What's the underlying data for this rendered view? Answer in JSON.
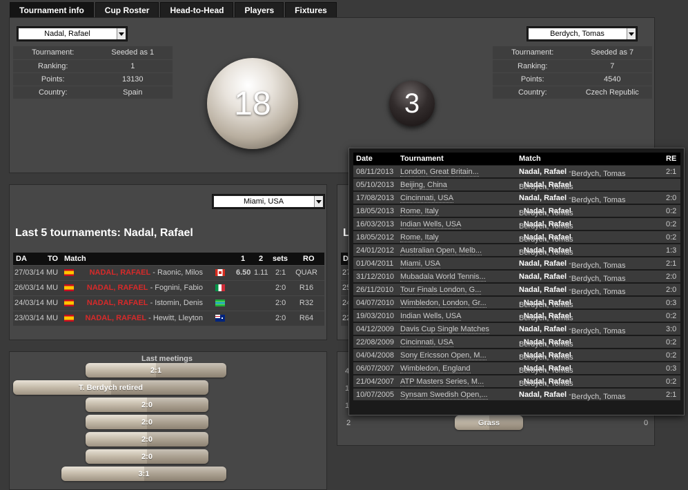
{
  "tabs": [
    "Tournament info",
    "Cup Roster",
    "Head-to-Head",
    "Players",
    "Fixtures"
  ],
  "player1": {
    "name": "Nadal, Rafael",
    "info": [
      [
        "Tournament:",
        "Seeded as 1"
      ],
      [
        "Ranking:",
        "1"
      ],
      [
        "Points:",
        "13130"
      ],
      [
        "Country:",
        "Spain"
      ]
    ],
    "wins": "18"
  },
  "player2": {
    "name": "Berdych, Tomas",
    "info": [
      [
        "Tournament:",
        "Seeded as 7"
      ],
      [
        "Ranking:",
        "7"
      ],
      [
        "Points:",
        "4540"
      ],
      [
        "Country:",
        "Czech Republic"
      ]
    ],
    "wins": "3"
  },
  "last5": {
    "filter": "Miami, USA",
    "title": "Last 5 tournaments: Nadal, Rafael",
    "headers": [
      "DA",
      "TO",
      "Match",
      "1",
      "2",
      "sets",
      "RO"
    ],
    "rows": [
      {
        "date": "27/03/14",
        "to": "MU",
        "player": "NADAL, RAFAEL",
        "opp": " - Raonic, Milos",
        "flag": "ca",
        "s1": "6.50",
        "s2": "1.11",
        "sets": "2:1",
        "ro": "QUAR"
      },
      {
        "date": "26/03/14",
        "to": "MU",
        "player": "NADAL, RAFAEL",
        "opp": " - Fognini, Fabio",
        "flag": "it",
        "s1": "",
        "s2": "",
        "sets": "2:0",
        "ro": "R16"
      },
      {
        "date": "24/03/14",
        "to": "MU",
        "player": "NADAL, RAFAEL",
        "opp": " - Istomin, Denis",
        "flag": "kz",
        "s1": "",
        "s2": "",
        "sets": "2:0",
        "ro": "R32"
      },
      {
        "date": "23/03/14",
        "to": "MU",
        "player": "NADAL, RAFAEL",
        "opp": " - Hewitt, Lleyton",
        "flag": "au",
        "s1": "",
        "s2": "",
        "sets": "2:0",
        "ro": "R64"
      }
    ]
  },
  "meetings": {
    "title": "Last meetings",
    "bars": [
      "2:1",
      "T. Berdych retired",
      "2:0",
      "2:0",
      "2:0",
      "2:0",
      "3:1"
    ]
  },
  "surface": {
    "left_value": "2",
    "label": "Grass",
    "right_value": "0"
  },
  "h2h": {
    "headers": [
      "Date",
      "Tournament",
      "Match",
      "RE"
    ],
    "rows": [
      {
        "date": "08/11/2013",
        "tournament": "London, Great Britain...",
        "a": "Nadal, Rafael",
        "b": "Berdych, Tomas",
        "winner": "a",
        "result": "2:1"
      },
      {
        "date": "05/10/2013",
        "tournament": "Beijing, China",
        "a": "Berdych, Tomas",
        "b": "Nadal, Rafael",
        "winner": "b",
        "result": ""
      },
      {
        "date": "17/08/2013",
        "tournament": "Cincinnati, USA",
        "a": "Nadal, Rafael",
        "b": "Berdych, Tomas",
        "winner": "a",
        "result": "2:0"
      },
      {
        "date": "18/05/2013",
        "tournament": "Rome, Italy",
        "a": "Berdych, Tomas",
        "b": "Nadal, Rafael",
        "winner": "b",
        "result": "0:2"
      },
      {
        "date": "16/03/2013",
        "tournament": "Indian Wells, USA",
        "a": "Berdych, Tomas",
        "b": "Nadal, Rafael",
        "winner": "b",
        "result": "0:2"
      },
      {
        "date": "18/05/2012",
        "tournament": "Rome, Italy",
        "a": "Berdych, Tomas",
        "b": "Nadal, Rafael",
        "winner": "b",
        "result": "0:2"
      },
      {
        "date": "24/01/2012",
        "tournament": "Australian Open, Melb...",
        "a": "Berdych, Tomas",
        "b": "Nadal, Rafael",
        "winner": "b",
        "result": "1:3"
      },
      {
        "date": "01/04/2011",
        "tournament": "Miami, USA",
        "a": "Nadal, Rafael",
        "b": "Berdych, Tomas",
        "winner": "a",
        "result": "2:1"
      },
      {
        "date": "31/12/2010",
        "tournament": "Mubadala World Tennis...",
        "a": "Nadal, Rafael",
        "b": "Berdych, Tomas",
        "winner": "a",
        "result": "2:0"
      },
      {
        "date": "26/11/2010",
        "tournament": "Tour Finals London, G...",
        "a": "Nadal, Rafael",
        "b": "Berdych, Tomas",
        "winner": "a",
        "result": "2:0"
      },
      {
        "date": "04/07/2010",
        "tournament": "Wimbledon, London, Gr...",
        "a": "Berdych, Tomas",
        "b": "Nadal, Rafael",
        "winner": "b",
        "result": "0:3"
      },
      {
        "date": "19/03/2010",
        "tournament": "Indian Wells, USA",
        "a": "Berdych, Tomas",
        "b": "Nadal, Rafael",
        "winner": "b",
        "result": "0:2"
      },
      {
        "date": "04/12/2009",
        "tournament": "Davis Cup Single Matches",
        "a": "Nadal, Rafael",
        "b": "Berdych, Tomas",
        "winner": "a",
        "result": "3:0"
      },
      {
        "date": "22/08/2009",
        "tournament": "Cincinnati, USA",
        "a": "Berdych, Tomas",
        "b": "Nadal, Rafael",
        "winner": "b",
        "result": "0:2"
      },
      {
        "date": "04/04/2008",
        "tournament": "Sony Ericsson Open, M...",
        "a": "Berdych, Tomas",
        "b": "Nadal, Rafael",
        "winner": "b",
        "result": "0:2"
      },
      {
        "date": "06/07/2007",
        "tournament": "Wimbledon, England",
        "a": "Berdych, Tomas",
        "b": "Nadal, Rafael",
        "winner": "b",
        "result": "0:3"
      },
      {
        "date": "21/04/2007",
        "tournament": "ATP Masters Series, M...",
        "a": "Berdych, Tomas",
        "b": "Nadal, Rafael",
        "winner": "b",
        "result": "0:2"
      },
      {
        "date": "10/07/2005",
        "tournament": "Synsam Swedish Open,...",
        "a": "Nadal, Rafael",
        "b": "Berdych, Tomas",
        "winner": "a",
        "result": "2:1"
      }
    ]
  }
}
